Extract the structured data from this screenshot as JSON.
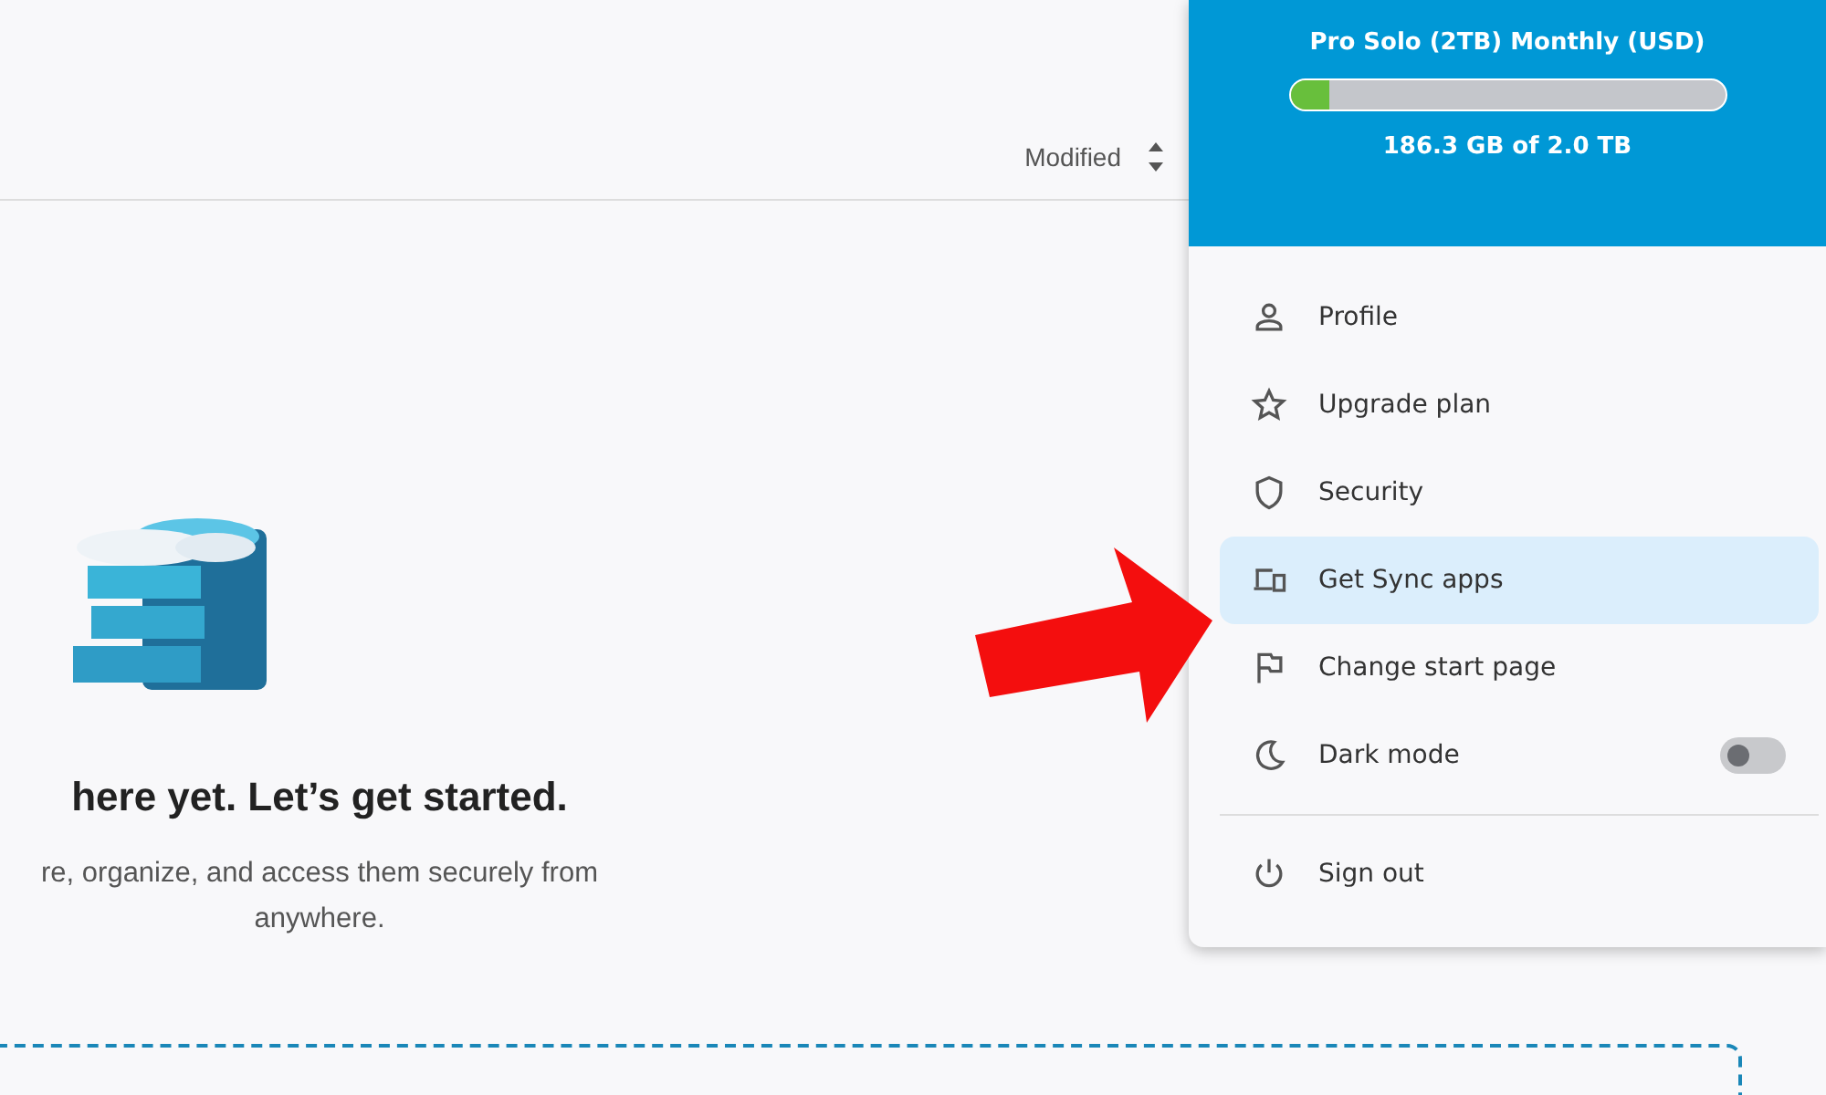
{
  "toolbar": {
    "sort_label": "Modified"
  },
  "empty_state": {
    "heading": "here yet. Let’s get started.",
    "text": "re, organize, and access them securely from anywhere."
  },
  "account_menu": {
    "plan": "Pro Solo (2TB) Monthly (USD)",
    "storage": {
      "level": 0.09,
      "reading": "186.3 GB of 2.0 TB"
    },
    "items": [
      {
        "kind": "link",
        "label": "Profile",
        "selected": false
      },
      {
        "kind": "link",
        "label": "Upgrade plan",
        "selected": false
      },
      {
        "kind": "link",
        "label": "Security",
        "selected": false
      },
      {
        "kind": "link",
        "label": "Get Sync apps",
        "selected": true
      },
      {
        "kind": "link",
        "label": "Change start page",
        "selected": false
      },
      {
        "kind": "toggle",
        "label": "Dark mode",
        "selected": false,
        "on": false
      },
      {
        "kind": "divider"
      },
      {
        "kind": "link",
        "label": "Sign out",
        "selected": false
      }
    ]
  }
}
